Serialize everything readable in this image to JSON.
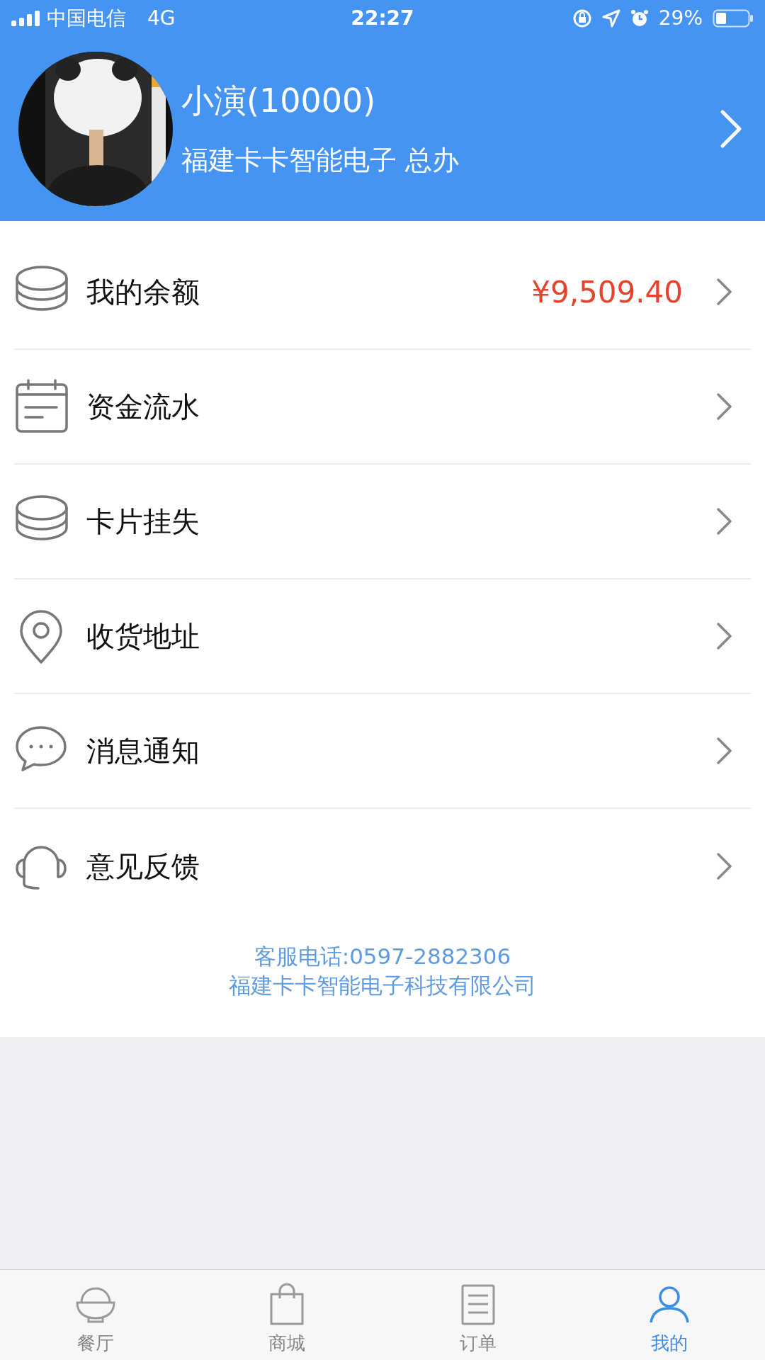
{
  "status_bar": {
    "carrier": "中国电信",
    "network": "4G",
    "time": "22:27",
    "battery": "29%"
  },
  "profile": {
    "name": "小演(10000)",
    "org": "福建卡卡智能电子 总办"
  },
  "menu": [
    {
      "label": "我的余额",
      "value": "¥9,509.40"
    },
    {
      "label": "资金流水"
    },
    {
      "label": "卡片挂失"
    },
    {
      "label": "收货地址"
    },
    {
      "label": "消息通知"
    },
    {
      "label": "意见反馈"
    }
  ],
  "footer": {
    "phone": "客服电话:0597-2882306",
    "company": "福建卡卡智能电子科技有限公司"
  },
  "tabs": [
    {
      "label": "餐厅",
      "selected": false
    },
    {
      "label": "商城",
      "selected": false
    },
    {
      "label": "订单",
      "selected": false
    },
    {
      "label": "我的",
      "selected": true
    }
  ]
}
